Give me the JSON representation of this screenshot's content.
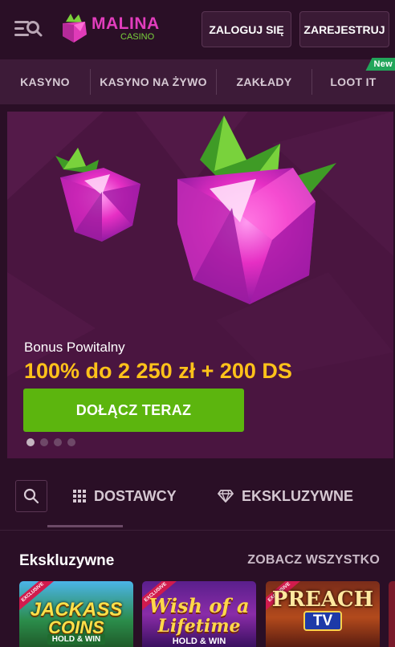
{
  "header": {
    "logo": {
      "main": "MALINA",
      "sub": "CASINO"
    },
    "login_label": "ZALOGUJ SIĘ",
    "register_label": "ZAREJESTRUJ"
  },
  "nav": {
    "items": [
      {
        "label": "KASYNO"
      },
      {
        "label": "KASYNO NA ŻYWO"
      },
      {
        "label": "ZAKŁADY"
      },
      {
        "label": "LOOT IT",
        "badge": "New"
      }
    ]
  },
  "banner": {
    "subtitle": "Bonus Powitalny",
    "title": "100% do 2 250 zł + 200 DS",
    "cta_label": "DOŁĄCZ TERAZ",
    "slides_total": 4,
    "active_slide": 1
  },
  "filters": {
    "tabs": [
      {
        "label": "DOSTAWCY",
        "icon": "grid-icon"
      },
      {
        "label": "EKSKLUZYWNE",
        "icon": "diamond-icon"
      }
    ]
  },
  "section": {
    "title": "Ekskluzywne",
    "see_all_label": "ZOBACZ WSZYSTKO"
  },
  "games": [
    {
      "ribbon": "EXCLUSIVE",
      "line1": "JACKASS",
      "line2": "COINS",
      "line3": "HOLD & WIN"
    },
    {
      "ribbon": "EXCLUSIVE",
      "line1": "Wish of a",
      "line2": "Lifetime",
      "line3": "HOLD & WIN"
    },
    {
      "ribbon": "EXCLUSIVE",
      "line1": "PREACH",
      "line2": "TV"
    }
  ],
  "colors": {
    "background": "#2a0f26",
    "nav_bg": "#3d1b38",
    "accent_pink": "#e23dbd",
    "accent_green": "#5cb50e",
    "bonus_yellow": "#ffc21a",
    "new_badge": "#22a55a"
  }
}
